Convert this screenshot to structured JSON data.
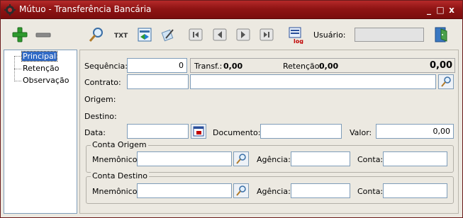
{
  "window": {
    "title": "Mútuo - Transferência Bancária"
  },
  "titlebar_controls": {
    "minimize": "_",
    "maximize": "□",
    "close": "x"
  },
  "toolbar": {
    "icons": [
      "add-icon",
      "remove-icon",
      "search-icon",
      "txt-icon",
      "refresh-icon",
      "edit-icon",
      "first-icon",
      "prev-icon",
      "next-icon",
      "last-icon",
      "log-icon",
      "exit-icon"
    ],
    "usuario_label": "Usuário:",
    "usuario_value": ""
  },
  "tree": {
    "items": [
      {
        "label": "Principal",
        "selected": true
      },
      {
        "label": "Retenção",
        "selected": false
      },
      {
        "label": "Observação",
        "selected": false
      }
    ]
  },
  "form": {
    "sequencia_label": "Sequência:",
    "sequencia_value": "0",
    "transf_label": "Transf.:",
    "transf_value": "0,00",
    "retencao_label": "Retenção:",
    "retencao_value": "0,00",
    "total_value": "0,00",
    "contrato_label": "Contrato:",
    "contrato_value": "",
    "contrato_desc": "",
    "origem_label": "Origem:",
    "destino_label": "Destino:",
    "data_label": "Data:",
    "data_value": "",
    "documento_label": "Documento:",
    "documento_value": "",
    "valor_label": "Valor:",
    "valor_value": "0,00"
  },
  "conta_origem": {
    "title": "Conta Origem",
    "mnemonico_label": "Mnemônico:",
    "mnemonico_value": "",
    "agencia_label": "Agência:",
    "agencia_value": "",
    "conta_label": "Conta:",
    "conta_value": ""
  },
  "conta_destino": {
    "title": "Conta Destino",
    "mnemonico_label": "Mnemônico:",
    "mnemonico_value": "",
    "agencia_label": "Agência:",
    "agencia_value": "",
    "conta_label": "Conta:",
    "conta_value": ""
  },
  "colors": {
    "titlebar": "#8f1414",
    "selection": "#316ac5",
    "field_border": "#7f9db9",
    "window_bg": "#ece9e1"
  }
}
